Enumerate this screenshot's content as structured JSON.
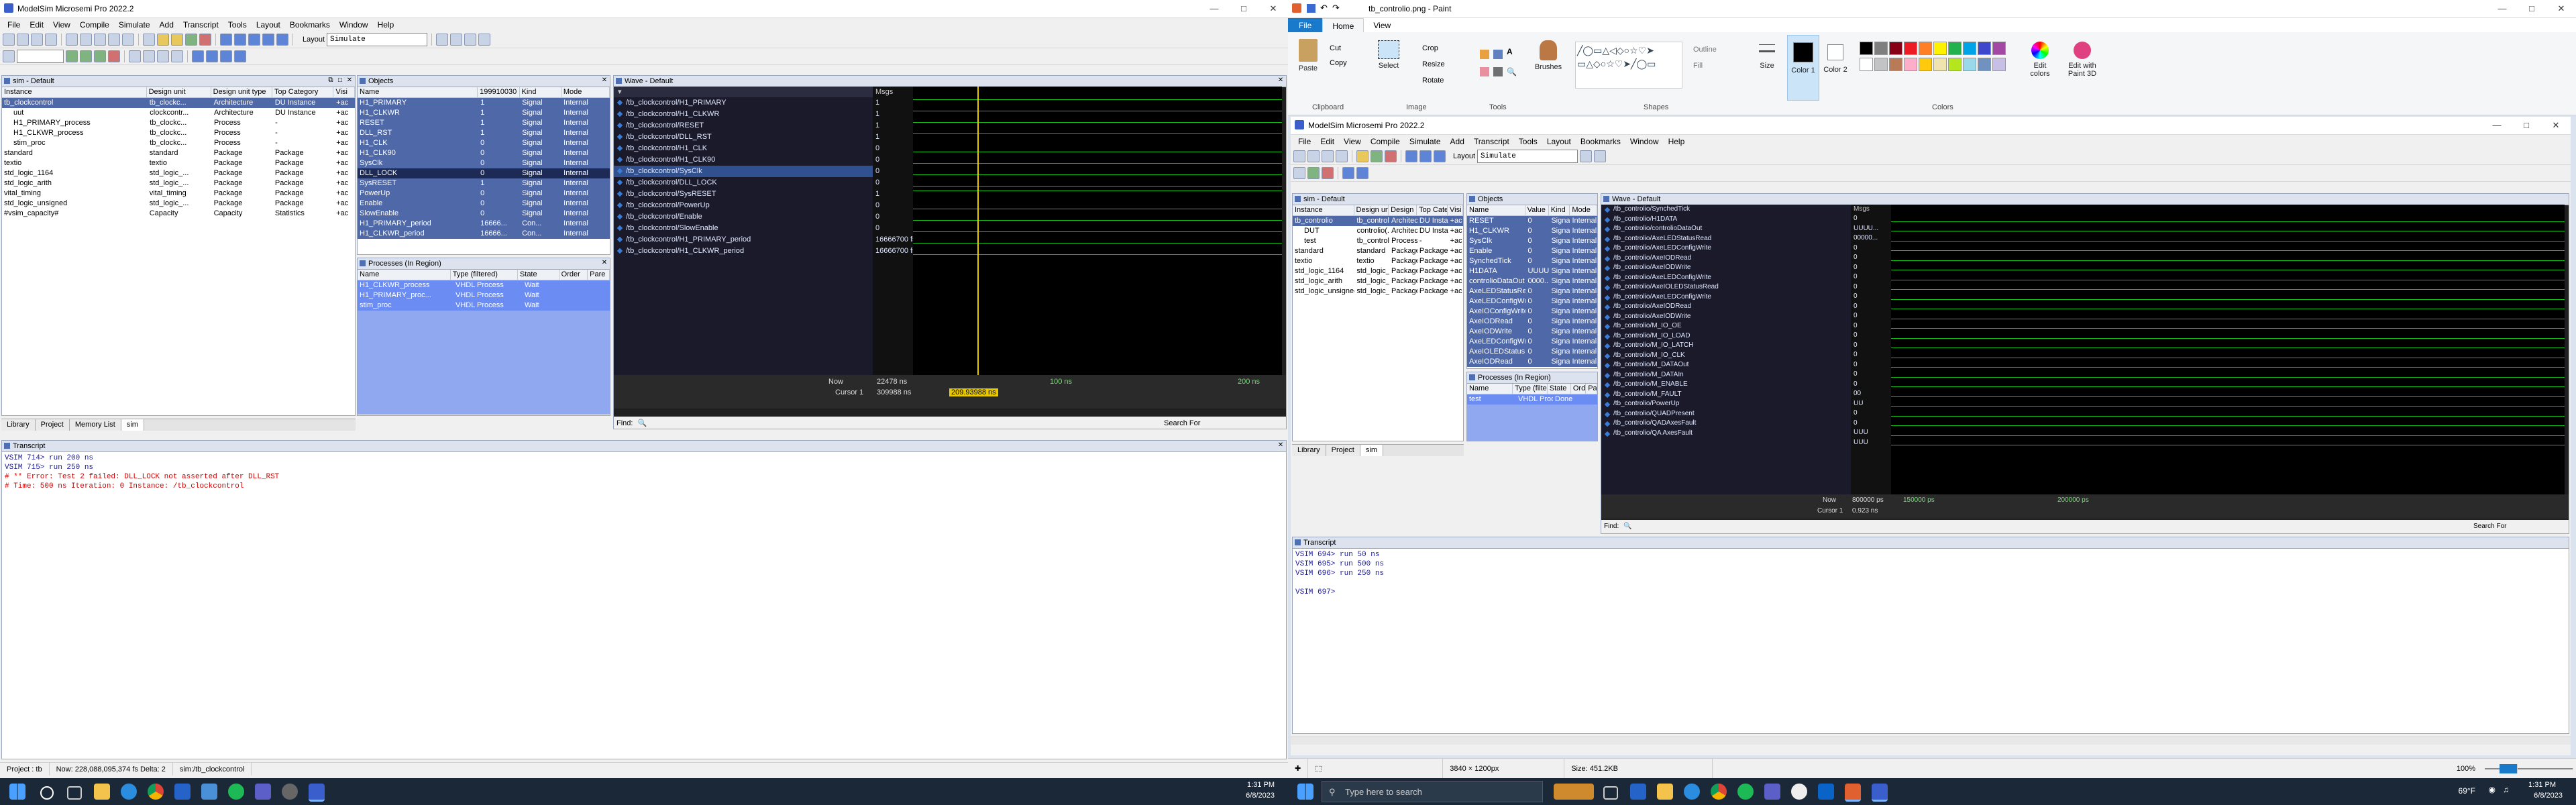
{
  "left": {
    "title": "ModelSim Microsemi Pro 2022.2",
    "menu": [
      "File",
      "Edit",
      "View",
      "Compile",
      "Simulate",
      "Add",
      "Transcript",
      "Tools",
      "Layout",
      "Bookmarks",
      "Window",
      "Help"
    ],
    "layout_label": "Layout",
    "layout_value": "Simulate",
    "sim": {
      "header": "sim - Default",
      "columns": [
        "Instance",
        "Design unit",
        "Design unit type",
        "Top Category",
        "Visi"
      ],
      "rows": [
        {
          "name": "tb_clockcontrol",
          "unit": "tb_clockc...",
          "type": "Architecture",
          "cat": "DU Instance",
          "vis": "+ac"
        },
        {
          "name": "uut",
          "unit": "clockcontr...",
          "type": "Architecture",
          "cat": "DU Instance",
          "vis": "+ac"
        },
        {
          "name": "H1_PRIMARY_process",
          "unit": "tb_clockc...",
          "type": "Process",
          "cat": "-",
          "vis": "+ac"
        },
        {
          "name": "H1_CLKWR_process",
          "unit": "tb_clockc...",
          "type": "Process",
          "cat": "-",
          "vis": "+ac"
        },
        {
          "name": "stim_proc",
          "unit": "tb_clockc...",
          "type": "Process",
          "cat": "-",
          "vis": "+ac"
        },
        {
          "name": "standard",
          "unit": "standard",
          "type": "Package",
          "cat": "Package",
          "vis": "+ac"
        },
        {
          "name": "textio",
          "unit": "textio",
          "type": "Package",
          "cat": "Package",
          "vis": "+ac"
        },
        {
          "name": "std_logic_1164",
          "unit": "std_logic_...",
          "type": "Package",
          "cat": "Package",
          "vis": "+ac"
        },
        {
          "name": "std_logic_arith",
          "unit": "std_logic_...",
          "type": "Package",
          "cat": "Package",
          "vis": "+ac"
        },
        {
          "name": "vital_timing",
          "unit": "vital_timing",
          "type": "Package",
          "cat": "Package",
          "vis": "+ac"
        },
        {
          "name": "std_logic_unsigned",
          "unit": "std_logic_...",
          "type": "Package",
          "cat": "Package",
          "vis": "+ac"
        },
        {
          "name": "#vsim_capacity#",
          "unit": "Capacity",
          "type": "Capacity",
          "cat": "Statistics",
          "vis": "+ac"
        }
      ]
    },
    "objects": {
      "header": "Objects",
      "columns": [
        "Name",
        "Value",
        "Kind",
        "Mode"
      ],
      "top_value": "199910030",
      "rows": [
        {
          "name": "H1_PRIMARY",
          "value": "1",
          "kind": "Signal",
          "mode": "Internal"
        },
        {
          "name": "H1_CLKWR",
          "value": "1",
          "kind": "Signal",
          "mode": "Internal"
        },
        {
          "name": "RESET",
          "value": "1",
          "kind": "Signal",
          "mode": "Internal"
        },
        {
          "name": "DLL_RST",
          "value": "1",
          "kind": "Signal",
          "mode": "Internal"
        },
        {
          "name": "H1_CLK",
          "value": "0",
          "kind": "Signal",
          "mode": "Internal"
        },
        {
          "name": "H1_CLK90",
          "value": "0",
          "kind": "Signal",
          "mode": "Internal"
        },
        {
          "name": "SysClk",
          "value": "0",
          "kind": "Signal",
          "mode": "Internal"
        },
        {
          "name": "DLL_LOCK",
          "value": "0",
          "kind": "Signal",
          "mode": "Internal"
        },
        {
          "name": "SysRESET",
          "value": "1",
          "kind": "Signal",
          "mode": "Internal"
        },
        {
          "name": "PowerUp",
          "value": "0",
          "kind": "Signal",
          "mode": "Internal"
        },
        {
          "name": "Enable",
          "value": "0",
          "kind": "Signal",
          "mode": "Internal"
        },
        {
          "name": "SlowEnable",
          "value": "0",
          "kind": "Signal",
          "mode": "Internal"
        },
        {
          "name": "H1_PRIMARY_period",
          "value": "16666...",
          "kind": "Con...",
          "mode": "Internal"
        },
        {
          "name": "H1_CLKWR_period",
          "value": "16666...",
          "kind": "Con...",
          "mode": "Internal"
        }
      ]
    },
    "processes": {
      "header": "Processes (In Region)",
      "columns": [
        "Name",
        "Type (filtered)",
        "State",
        "Order",
        "Pare"
      ],
      "rows": [
        {
          "name": "H1_CLKWR_process",
          "type": "VHDL Process",
          "state": "Wait"
        },
        {
          "name": "H1_PRIMARY_proc...",
          "type": "VHDL Process",
          "state": "Wait"
        },
        {
          "name": "stim_proc",
          "type": "VHDL Process",
          "state": "Wait"
        }
      ]
    },
    "wave": {
      "header": "Wave - Default",
      "msgs_label": "Msgs",
      "signals": [
        {
          "name": "/tb_clockcontrol/H1_PRIMARY",
          "value": "1"
        },
        {
          "name": "/tb_clockcontrol/H1_CLKWR",
          "value": "1"
        },
        {
          "name": "/tb_clockcontrol/RESET",
          "value": "1"
        },
        {
          "name": "/tb_clockcontrol/DLL_RST",
          "value": "1"
        },
        {
          "name": "/tb_clockcontrol/H1_CLK",
          "value": "0"
        },
        {
          "name": "/tb_clockcontrol/H1_CLK90",
          "value": "0"
        },
        {
          "name": "/tb_clockcontrol/SysClk",
          "value": "0"
        },
        {
          "name": "/tb_clockcontrol/DLL_LOCK",
          "value": "0"
        },
        {
          "name": "/tb_clockcontrol/SysRESET",
          "value": "1"
        },
        {
          "name": "/tb_clockcontrol/PowerUp",
          "value": "0"
        },
        {
          "name": "/tb_clockcontrol/Enable",
          "value": "0"
        },
        {
          "name": "/tb_clockcontrol/SlowEnable",
          "value": "0"
        },
        {
          "name": "/tb_clockcontrol/H1_PRIMARY_period",
          "value": "16666700 fs"
        },
        {
          "name": "/tb_clockcontrol/H1_CLKWR_period",
          "value": "16666700 fs"
        }
      ],
      "now_label": "Now",
      "now_value": "22478 ns",
      "cursor_label": "Cursor 1",
      "cursor_value": "309988 ns",
      "cursor_readout": "209.93988 ns",
      "tick1": "100 ns",
      "tick2": "200 ns",
      "find_label": "Find:",
      "search_label": "Search For"
    },
    "tabs": [
      "Library",
      "Project",
      "Memory List",
      "sim"
    ],
    "transcript": {
      "header": "Transcript",
      "lines": [
        {
          "text": "VSIM 714> run 200 ns",
          "err": false
        },
        {
          "text": "VSIM 715> run 250 ns",
          "err": false
        },
        {
          "text": "# ** Error: Test 2 failed: DLL_LOCK not asserted after DLL_RST",
          "err": false
        },
        {
          "text": "#    Time: 500 ns  Iteration: 0  Instance: /tb_clockcontrol",
          "err": false
        }
      ]
    },
    "status": [
      "Project : tb",
      "Now: 228,088,095,374 fs  Delta: 2",
      "sim:/tb_clockcontrol"
    ]
  },
  "paint": {
    "title": "tb_controlio.png - Paint",
    "tabs": [
      "File",
      "Home",
      "View"
    ],
    "groups": {
      "clipboard": "Clipboard",
      "image": "Image",
      "tools": "Tools",
      "shapes": "Shapes",
      "colors": "Colors"
    },
    "buttons": {
      "paste": "Paste",
      "cut": "Cut",
      "copy": "Copy",
      "select": "Select",
      "crop": "Crop",
      "resize": "Resize",
      "rotate": "Rotate",
      "brushes": "Brushes",
      "outline": "Outline",
      "fill": "Fill",
      "size": "Size",
      "color1": "Color 1",
      "color2": "Color 2",
      "edit_colors": "Edit colors",
      "edit_paint3d": "Edit with Paint 3D"
    },
    "status_dims": "3840 × 1200px",
    "status_size": "Size: 451.2KB",
    "zoom": "100%",
    "palette": [
      "#000000",
      "#7f7f7f",
      "#880015",
      "#ed1c24",
      "#ff7f27",
      "#fff200",
      "#22b14c",
      "#00a2e8",
      "#3f48cc",
      "#a349a4",
      "#ffffff",
      "#c3c3c3",
      "#b97a57",
      "#ffaec9",
      "#ffc90e",
      "#efe4b0",
      "#b5e61d",
      "#99d9ea",
      "#7092be",
      "#c8bfe7"
    ]
  },
  "inner": {
    "title": "ModelSim Microsemi Pro 2022.2",
    "menu": [
      "File",
      "Edit",
      "View",
      "Compile",
      "Simulate",
      "Add",
      "Transcript",
      "Tools",
      "Layout",
      "Bookmarks",
      "Window",
      "Help"
    ],
    "layout_label": "Layout",
    "layout_value": "Simulate",
    "sim": {
      "header": "sim - Default",
      "columns": [
        "Instance",
        "Design unit",
        "Design unit type",
        "Top Category",
        "Visi"
      ],
      "rows": [
        {
          "name": "tb_controlio",
          "unit": "tb_controlio",
          "type": "Architecture",
          "cat": "DU Instance",
          "vis": "+ac"
        },
        {
          "name": "DUT",
          "unit": "controlio(...",
          "type": "Architecture",
          "cat": "DU Instance",
          "vis": "+ac"
        },
        {
          "name": "test",
          "unit": "tb_controlio",
          "type": "Process",
          "cat": "-",
          "vis": "+ac"
        },
        {
          "name": "standard",
          "unit": "standard",
          "type": "Package",
          "cat": "Package",
          "vis": "+ac"
        },
        {
          "name": "textio",
          "unit": "textio",
          "type": "Package",
          "cat": "Package",
          "vis": "+ac"
        },
        {
          "name": "std_logic_1164",
          "unit": "std_logic_...",
          "type": "Package",
          "cat": "Package",
          "vis": "+ac"
        },
        {
          "name": "std_logic_arith",
          "unit": "std_logic_...",
          "type": "Package",
          "cat": "Package",
          "vis": "+ac"
        },
        {
          "name": "std_logic_unsigned",
          "unit": "std_logic_...",
          "type": "Package",
          "cat": "Package",
          "vis": "+ac"
        }
      ]
    },
    "objects": {
      "header": "Objects",
      "columns": [
        "Name",
        "Value",
        "Kind",
        "Mode"
      ],
      "rows": [
        {
          "name": "RESET",
          "value": "0",
          "kind": "Signal",
          "mode": "Internal"
        },
        {
          "name": "H1_CLKWR",
          "value": "0",
          "kind": "Signal",
          "mode": "Internal"
        },
        {
          "name": "SysClk",
          "value": "0",
          "kind": "Signal",
          "mode": "Internal"
        },
        {
          "name": "Enable",
          "value": "0",
          "kind": "Signal",
          "mode": "Internal"
        },
        {
          "name": "SynchedTick",
          "value": "0",
          "kind": "Signal",
          "mode": "Internal"
        },
        {
          "name": "H1DATA",
          "value": "UUUU...",
          "kind": "Signal",
          "mode": "Internal"
        },
        {
          "name": "controlioDataOut",
          "value": "0000...",
          "kind": "Signal",
          "mode": "Internal"
        },
        {
          "name": "AxeLEDStatusRead",
          "value": "0",
          "kind": "Signal",
          "mode": "Internal"
        },
        {
          "name": "AxeLEDConfigWrite",
          "value": "0",
          "kind": "Signal",
          "mode": "Internal"
        },
        {
          "name": "AxeIOConfigWrite",
          "value": "0",
          "kind": "Signal",
          "mode": "Internal"
        },
        {
          "name": "AxeIODRead",
          "value": "0",
          "kind": "Signal",
          "mode": "Internal"
        },
        {
          "name": "AxeIODWrite",
          "value": "0",
          "kind": "Signal",
          "mode": "Internal"
        },
        {
          "name": "AxeLEDConfigWrite",
          "value": "0",
          "kind": "Signal",
          "mode": "Internal"
        },
        {
          "name": "AxeIOLEDStatusRead",
          "value": "0",
          "kind": "Signal",
          "mode": "Internal"
        },
        {
          "name": "AxeIODRead",
          "value": "0",
          "kind": "Signal",
          "mode": "Internal"
        }
      ]
    },
    "processes": {
      "header": "Processes (In Region)",
      "columns": [
        "Name",
        "Type (filtered)",
        "State",
        "Order",
        "Pare"
      ],
      "rows": [
        {
          "name": "test",
          "type": "VHDL Process",
          "state": "Done"
        }
      ]
    },
    "wave": {
      "header": "Wave - Default",
      "msgs_label": "Msgs",
      "signals": [
        {
          "name": "/tb_controlio/SynchedTick",
          "value": "0"
        },
        {
          "name": "/tb_controlio/H1DATA",
          "value": "UUUU..."
        },
        {
          "name": "/tb_controlio/controlioDataOut",
          "value": "00000..."
        },
        {
          "name": "/tb_controlio/AxeLEDStatusRead",
          "value": "0"
        },
        {
          "name": "/tb_controlio/AxeLEDConfigWrite",
          "value": "0"
        },
        {
          "name": "/tb_controlio/AxeIODRead",
          "value": "0"
        },
        {
          "name": "/tb_controlio/AxeIODWrite",
          "value": "0"
        },
        {
          "name": "/tb_controlio/AxeLEDConfigWrite",
          "value": "0"
        },
        {
          "name": "/tb_controlio/AxeIOLEDStatusRead",
          "value": "0"
        },
        {
          "name": "/tb_controlio/AxeLEDConfigWrite",
          "value": "0"
        },
        {
          "name": "/tb_controlio/AxeIODRead",
          "value": "0"
        },
        {
          "name": "/tb_controlio/AxeIODWrite",
          "value": "0"
        },
        {
          "name": "/tb_controlio/M_IO_OE",
          "value": "0"
        },
        {
          "name": "/tb_controlio/M_IO_LOAD",
          "value": "0"
        },
        {
          "name": "/tb_controlio/M_IO_LATCH",
          "value": "0"
        },
        {
          "name": "/tb_controlio/M_IO_CLK",
          "value": "0"
        },
        {
          "name": "/tb_controlio/M_DATAOut",
          "value": "0"
        },
        {
          "name": "/tb_controlio/M_DATAIn",
          "value": "0"
        },
        {
          "name": "/tb_controlio/M_ENABLE",
          "value": "00"
        },
        {
          "name": "/tb_controlio/M_FAULT",
          "value": "UU"
        },
        {
          "name": "/tb_controlio/PowerUp",
          "value": "0"
        },
        {
          "name": "/tb_controlio/QUADPresent",
          "value": "0"
        },
        {
          "name": "/tb_controlio/QADAxesFault",
          "value": "UUU"
        },
        {
          "name": "/tb_controlio/QA AxesFault",
          "value": "UUU"
        }
      ],
      "now_label": "Now",
      "now_value": "800000 ps",
      "cursor_label": "Cursor 1",
      "cursor_value": "0.923 ns",
      "tick1": "150000 ps",
      "tick2": "200000 ps",
      "find_label": "Find:",
      "search_label": "Search For"
    },
    "tabs": [
      "Library",
      "Project",
      "sim"
    ],
    "transcript": {
      "header": "Transcript",
      "lines": [
        "VSIM 694> run 50 ns",
        "VSIM 695> run 500 ns",
        "VSIM 696> run 250 ns",
        "",
        "VSIM 697>"
      ]
    }
  },
  "taskbar": {
    "search_placeholder": "Type here to search",
    "left_clock_time": "1:31 PM",
    "left_clock_date": "6/8/2023",
    "right_clock_time": "1:31 PM",
    "right_clock_date": "6/8/2023",
    "weather": "69°F"
  }
}
